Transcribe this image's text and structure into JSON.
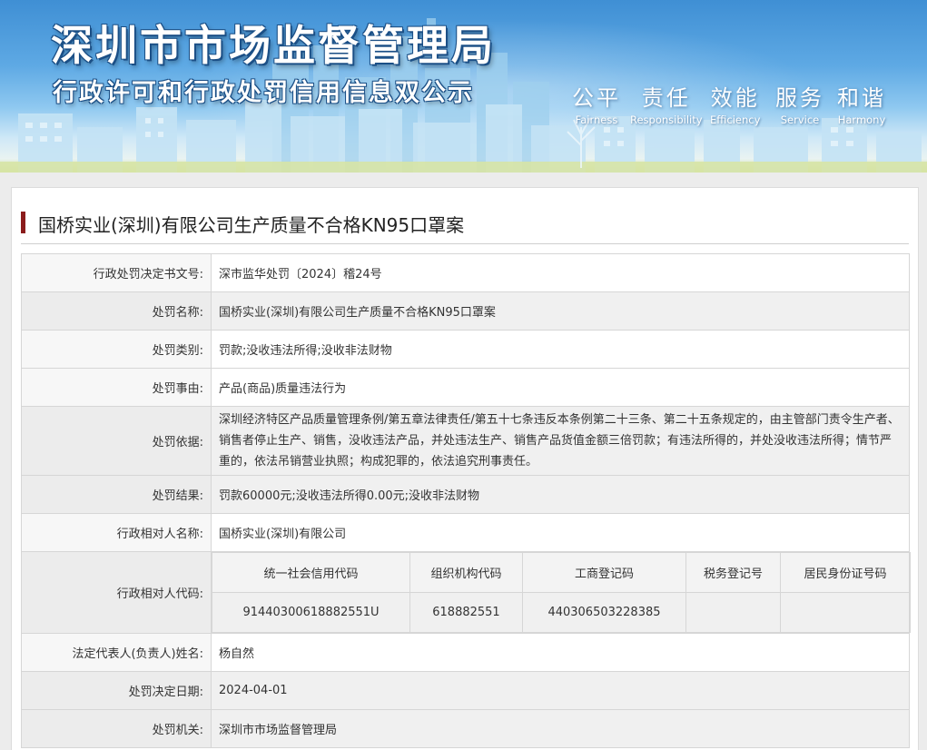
{
  "banner": {
    "title_main": "深圳市市场监督管理局",
    "title_sub": "行政许可和行政处罚信用信息双公示",
    "values": [
      {
        "zh": "公平",
        "en": "Fairness"
      },
      {
        "zh": "责任",
        "en": "Responsibility"
      },
      {
        "zh": "效能",
        "en": "Efficiency"
      },
      {
        "zh": "服务",
        "en": "Service"
      },
      {
        "zh": "和谐",
        "en": "Harmony"
      }
    ]
  },
  "case": {
    "title": "国桥实业(深圳)有限公司生产质量不合格KN95口罩案",
    "accent_color": "#8b1c1c"
  },
  "rows": {
    "decision_no": {
      "label": "行政处罚决定书文号:",
      "value": "深市监华处罚〔2024〕稽24号"
    },
    "penalty_name": {
      "label": "处罚名称:",
      "value": "国桥实业(深圳)有限公司生产质量不合格KN95口罩案"
    },
    "penalty_type": {
      "label": "处罚类别:",
      "value": "罚款;没收违法所得;没收非法财物"
    },
    "penalty_reason": {
      "label": "处罚事由:",
      "value": "产品(商品)质量违法行为"
    },
    "penalty_basis": {
      "label": "处罚依据:",
      "value": "深圳经济特区产品质量管理条例/第五章法律责任/第五十七条违反本条例第二十三条、第二十五条规定的，由主管部门责令生产者、销售者停止生产、销售，没收违法产品，并处违法生产、销售产品货值金额三倍罚款；有违法所得的，并处没收违法所得；情节严重的，依法吊销营业执照；构成犯罪的，依法追究刑事责任。"
    },
    "penalty_result": {
      "label": "处罚结果:",
      "value": "罚款60000元;没收违法所得0.00元;没收非法财物"
    },
    "party_name": {
      "label": "行政相对人名称:",
      "value": "国桥实业(深圳)有限公司"
    },
    "party_codes": {
      "label": "行政相对人代码:",
      "headers": [
        "统一社会信用代码",
        "组织机构代码",
        "工商登记码",
        "税务登记号",
        "居民身份证号码"
      ],
      "values": [
        "91440300618882551U",
        "618882551",
        "440306503228385",
        "",
        ""
      ]
    },
    "legal_rep": {
      "label": "法定代表人(负责人)姓名:",
      "value": "杨自然"
    },
    "decision_date": {
      "label": "处罚决定日期:",
      "value": "2024-04-01"
    },
    "authority": {
      "label": "处罚机关:",
      "value": "深圳市市场监督管理局"
    }
  }
}
